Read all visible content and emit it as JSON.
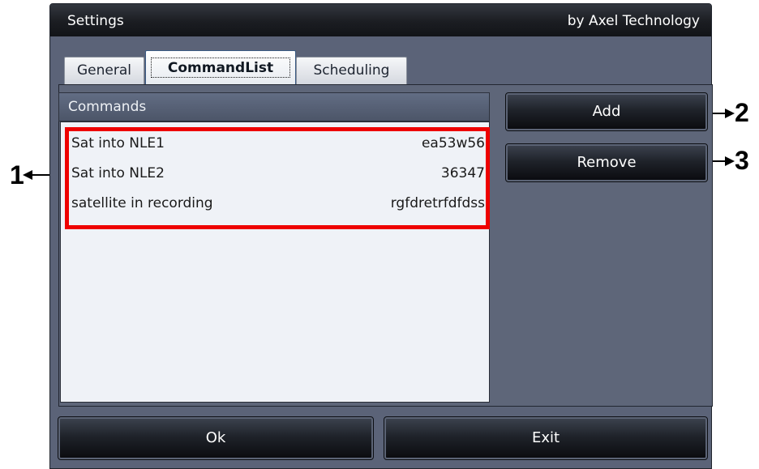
{
  "window": {
    "title": "Settings",
    "vendor": "by Axel Technology"
  },
  "tabs": [
    {
      "label": "General",
      "active": false
    },
    {
      "label": "CommandList",
      "active": true
    },
    {
      "label": "Scheduling",
      "active": false
    }
  ],
  "commands": {
    "header": "Commands",
    "items": [
      {
        "name": "Sat into NLE1",
        "code": "ea53w56"
      },
      {
        "name": "Sat into NLE2",
        "code": "36347"
      },
      {
        "name": "satellite in recording",
        "code": "rgfdretrfdfdss"
      }
    ]
  },
  "actions": {
    "add_label": "Add",
    "remove_label": "Remove"
  },
  "footer": {
    "ok_label": "Ok",
    "exit_label": "Exit"
  },
  "callouts": {
    "list": "1",
    "add": "2",
    "remove": "3"
  },
  "colors": {
    "window_bg": "#5b6378",
    "highlight": "#ee0000",
    "list_bg": "#eff2f7"
  }
}
